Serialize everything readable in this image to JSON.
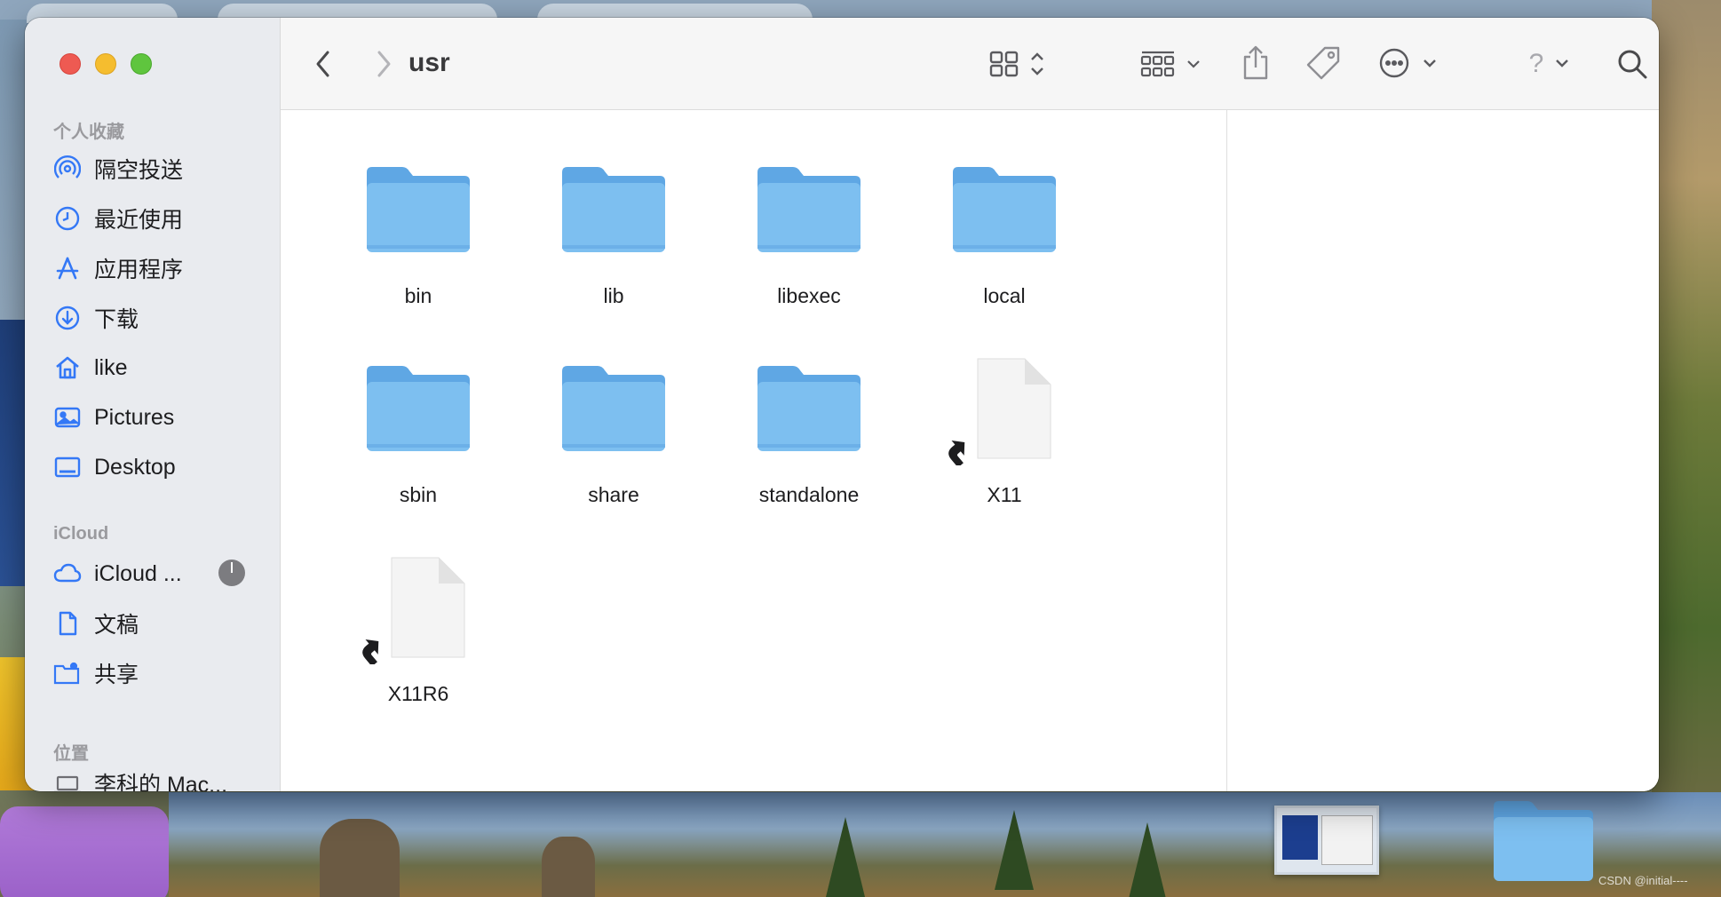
{
  "window": {
    "title": "usr"
  },
  "sidebar": {
    "sections": {
      "favorites": "个人收藏",
      "icloud": "iCloud",
      "locations": "位置"
    },
    "items": [
      {
        "label": "隔空投送",
        "icon": "airdrop-icon"
      },
      {
        "label": "最近使用",
        "icon": "clock-icon"
      },
      {
        "label": "应用程序",
        "icon": "applications-icon"
      },
      {
        "label": "下载",
        "icon": "download-icon"
      },
      {
        "label": "like",
        "icon": "home-icon"
      },
      {
        "label": "Pictures",
        "icon": "photo-icon"
      },
      {
        "label": "Desktop",
        "icon": "desktop-icon"
      },
      {
        "label": "iCloud ...",
        "icon": "cloud-icon"
      },
      {
        "label": "文稿",
        "icon": "document-icon"
      },
      {
        "label": "共享",
        "icon": "shared-folder-icon"
      },
      {
        "label": "李科的 Mac...",
        "icon": "laptop-icon"
      }
    ]
  },
  "toolbar": {
    "back": "back-chevron-icon",
    "forward": "forward-chevron-icon",
    "view_mode": "icon-grid-icon",
    "group": "group-by-icon",
    "share": "share-icon",
    "tag": "tag-icon",
    "more": "ellipsis-circle-icon",
    "help": "?",
    "search": "search-icon"
  },
  "files": [
    {
      "name": "bin",
      "type": "folder"
    },
    {
      "name": "lib",
      "type": "folder"
    },
    {
      "name": "libexec",
      "type": "folder"
    },
    {
      "name": "local",
      "type": "folder"
    },
    {
      "name": "sbin",
      "type": "folder"
    },
    {
      "name": "share",
      "type": "folder"
    },
    {
      "name": "standalone",
      "type": "folder"
    },
    {
      "name": "X11",
      "type": "alias"
    },
    {
      "name": "X11R6",
      "type": "alias"
    }
  ],
  "desktop": {
    "watermark": "CSDN @initial----"
  },
  "colors": {
    "folder": "#7dbff0",
    "folder_tab": "#5fa7e4",
    "accent": "#3478f6"
  }
}
